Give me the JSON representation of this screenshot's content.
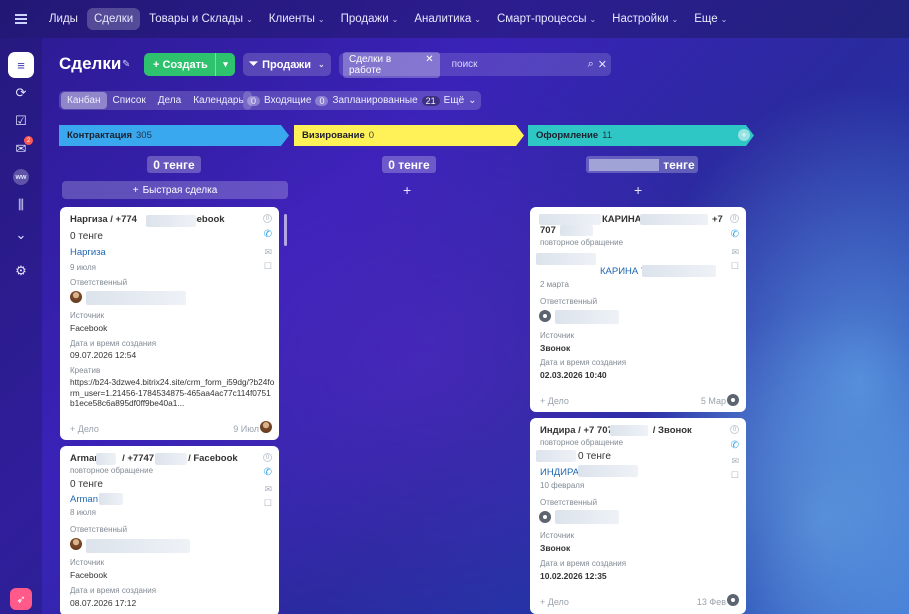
{
  "topnav": {
    "items": [
      {
        "label": "Лиды",
        "caret": false,
        "active": false
      },
      {
        "label": "Сделки",
        "caret": false,
        "active": true
      },
      {
        "label": "Товары и Склады",
        "caret": true,
        "active": false
      },
      {
        "label": "Клиенты",
        "caret": true,
        "active": false
      },
      {
        "label": "Продажи",
        "caret": true,
        "active": false
      },
      {
        "label": "Аналитика",
        "caret": true,
        "active": false
      },
      {
        "label": "Смарт-процессы",
        "caret": true,
        "active": false
      },
      {
        "label": "Настройки",
        "caret": true,
        "active": false
      },
      {
        "label": "Еще",
        "caret": true,
        "active": false
      }
    ]
  },
  "rail": {
    "badge": "2",
    "ww": "ww"
  },
  "header": {
    "title": "Сделки",
    "create_label": "Создать",
    "pipeline_label": "Продажи",
    "filter_chip": "Сделки в работе",
    "search_placeholder": "поиск"
  },
  "views": [
    "Канбан",
    "Список",
    "Дела",
    "Календарь"
  ],
  "counters": [
    {
      "count": "0",
      "label": "Входящие"
    },
    {
      "count": "0",
      "label": "Запланированные"
    },
    {
      "count": "21",
      "label": "Ещё"
    }
  ],
  "columns": [
    {
      "name": "Контрактация",
      "count": "305",
      "sum": "0 тенге",
      "color": "#39a8ef",
      "quick": "Быстрая сделка"
    },
    {
      "name": "Визирование",
      "count": "0",
      "sum": "0 тенге",
      "color": "#fff259"
    },
    {
      "name": "Оформление",
      "count": "11",
      "sum": "тенге",
      "color": "#2fc6c6"
    }
  ],
  "cards": {
    "c1": {
      "title_a": "Наргиза / +774",
      "title_b": "/ Facebook",
      "money": "0 тенге",
      "contact": "Наргиза",
      "date": "9 июля",
      "resp_label": "Ответственный",
      "source_label": "Источник",
      "source": "Facebook",
      "created_label": "Дата и время создания",
      "created": "09.07.2026 12:54",
      "creative_label": "Креатив",
      "creative": "https://b24-3dzwe4.bitrix24.site/crm_form_i59dg/?b24form_user=1.21456-1784534875-465aa4ac77c114f0751b1ece58c6a895df0ff9be40a1...",
      "activity": "+ Дело",
      "act_date": "9 Июл"
    },
    "c2": {
      "title_a": "Arman",
      "title_b": "/ +7747",
      "title_c": "/ Facebook",
      "repeat": "повторное обращение",
      "money": "0 тенге",
      "contact": "Arman",
      "date": "8 июля",
      "resp_label": "Ответственный",
      "source_label": "Источник",
      "source": "Facebook",
      "created_label": "Дата и время создания",
      "created": "08.07.2026 17:12"
    },
    "c3": {
      "title_a": "КАРИНА",
      "title_b": "+7",
      "title_c": "707",
      "repeat": "повторное обращение",
      "contact": "КАРИНА Т",
      "date": "2 марта",
      "resp_label": "Ответственный",
      "source_label": "Источник",
      "source": "Звонок",
      "created_label": "Дата и время создания",
      "created": "02.03.2026 10:40",
      "activity": "+ Дело",
      "act_date": "5 Мар"
    },
    "c4": {
      "title_a": "Индира / +7 707",
      "title_b": "/ Звонок",
      "repeat": "повторное обращение",
      "money": "0 тенге",
      "contact": "ИНДИРА",
      "date": "10 февраля",
      "resp_label": "Ответственный",
      "source_label": "Источник",
      "source": "Звонок",
      "created_label": "Дата и время создания",
      "created": "10.02.2026 12:35",
      "activity": "+ Дело",
      "act_date": "13 Фев"
    }
  }
}
